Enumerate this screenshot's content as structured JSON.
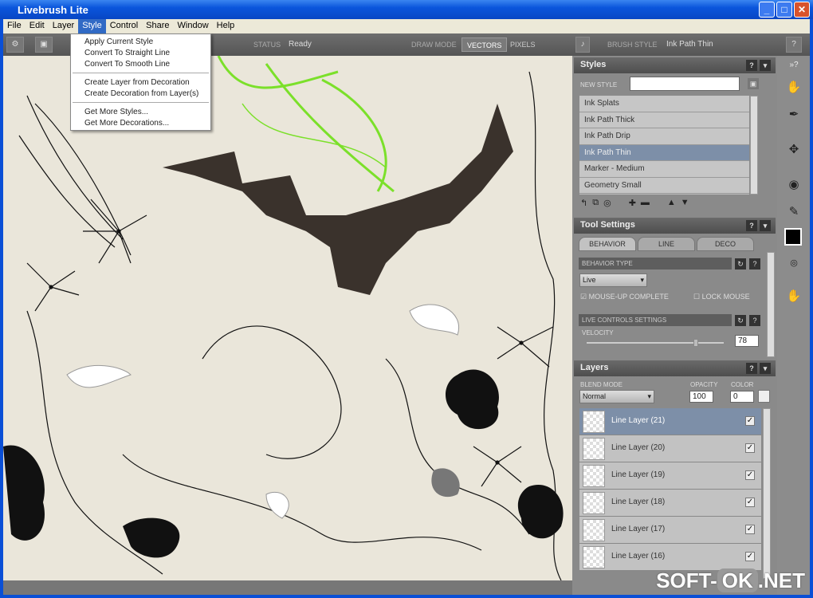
{
  "window": {
    "title": "Livebrush Lite",
    "minimize": "_",
    "maximize": "□",
    "close": "✕"
  },
  "menu": [
    "File",
    "Edit",
    "Layer",
    "Style",
    "Control",
    "Share",
    "Window",
    "Help"
  ],
  "style_menu": {
    "group1": [
      "Apply Current Style",
      "Convert To Straight Line",
      "Convert To Smooth Line"
    ],
    "group2": [
      "Create Layer from Decoration",
      "Create Decoration from Layer(s)"
    ],
    "group3": [
      "Get More Styles...",
      "Get More Decorations..."
    ]
  },
  "toolbar": {
    "status_label": "STATUS",
    "status_value": "Ready",
    "draw_mode_label": "DRAW MODE",
    "vectors": "VECTORS",
    "pixels": "PIXELS",
    "brush_style_label": "BRUSH STYLE",
    "brush_style_value": "Ink Path Thin",
    "help": "?"
  },
  "styles": {
    "title": "Styles",
    "new_style_label": "NEW STYLE",
    "new_style_value": "",
    "items": [
      "Ink Splats",
      "Ink Path Thick",
      "Ink Path Drip",
      "Ink Path Thin",
      "Marker - Medium",
      "Geometry Small"
    ],
    "selected": "Ink Path Thin"
  },
  "tool_settings": {
    "title": "Tool Settings",
    "tabs": [
      "BEHAVIOR",
      "LINE",
      "DECO"
    ],
    "behavior_type_label": "BEHAVIOR TYPE",
    "behavior_type_value": "Live",
    "mouse_up_complete": "MOUSE-UP COMPLETE",
    "lock_mouse": "LOCK MOUSE",
    "live_controls_label": "LIVE CONTROLS SETTINGS",
    "velocity_label": "VELOCITY",
    "velocity_value": "78"
  },
  "layers": {
    "title": "Layers",
    "blend_mode_label": "BLEND MODE",
    "blend_mode_value": "Normal",
    "opacity_label": "OPACITY",
    "opacity_value": "100",
    "color_label": "COLOR",
    "color_value": "0",
    "items": [
      "Line Layer (21)",
      "Line Layer (20)",
      "Line Layer (19)",
      "Line Layer (18)",
      "Line Layer (17)",
      "Line Layer (16)"
    ]
  },
  "watermark": {
    "a": "SOFT-",
    "b": "OK",
    ".c": "",
    "c": ".NET"
  },
  "colors": {
    "accent": "#316ac5",
    "canvas": "#eae6da",
    "green": "#7be02a",
    "ink": "#3a322c"
  }
}
